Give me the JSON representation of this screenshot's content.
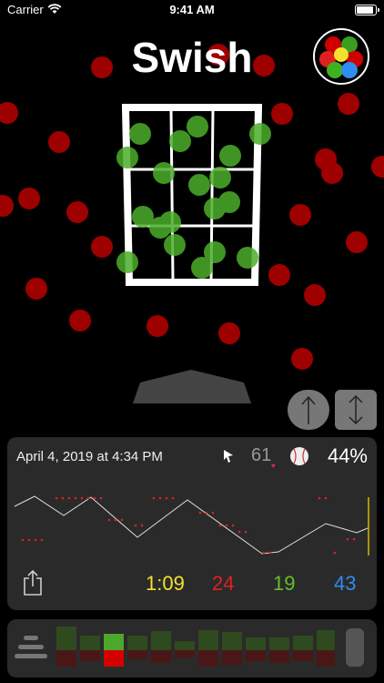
{
  "status": {
    "carrier": "Carrier",
    "time": "9:41 AM"
  },
  "app": {
    "title": "Swish"
  },
  "card": {
    "date": "April 4, 2019 at 4:34 PM",
    "pitch": "61",
    "percent": "44%"
  },
  "stats": {
    "time": "1:09",
    "misses": "24",
    "makes": "19",
    "total": "43"
  },
  "icons": {
    "logo": "color-balls-icon",
    "up": "arrow-up-icon",
    "updown": "arrow-updown-icon",
    "share": "share-icon",
    "menu": "menu-icon",
    "cursor": "cursor-icon",
    "ball": "baseball-icon"
  },
  "colors": {
    "miss": "#e02020",
    "make": "#63c12a",
    "time": "#f5e02e",
    "total": "#2f8cf0"
  }
}
